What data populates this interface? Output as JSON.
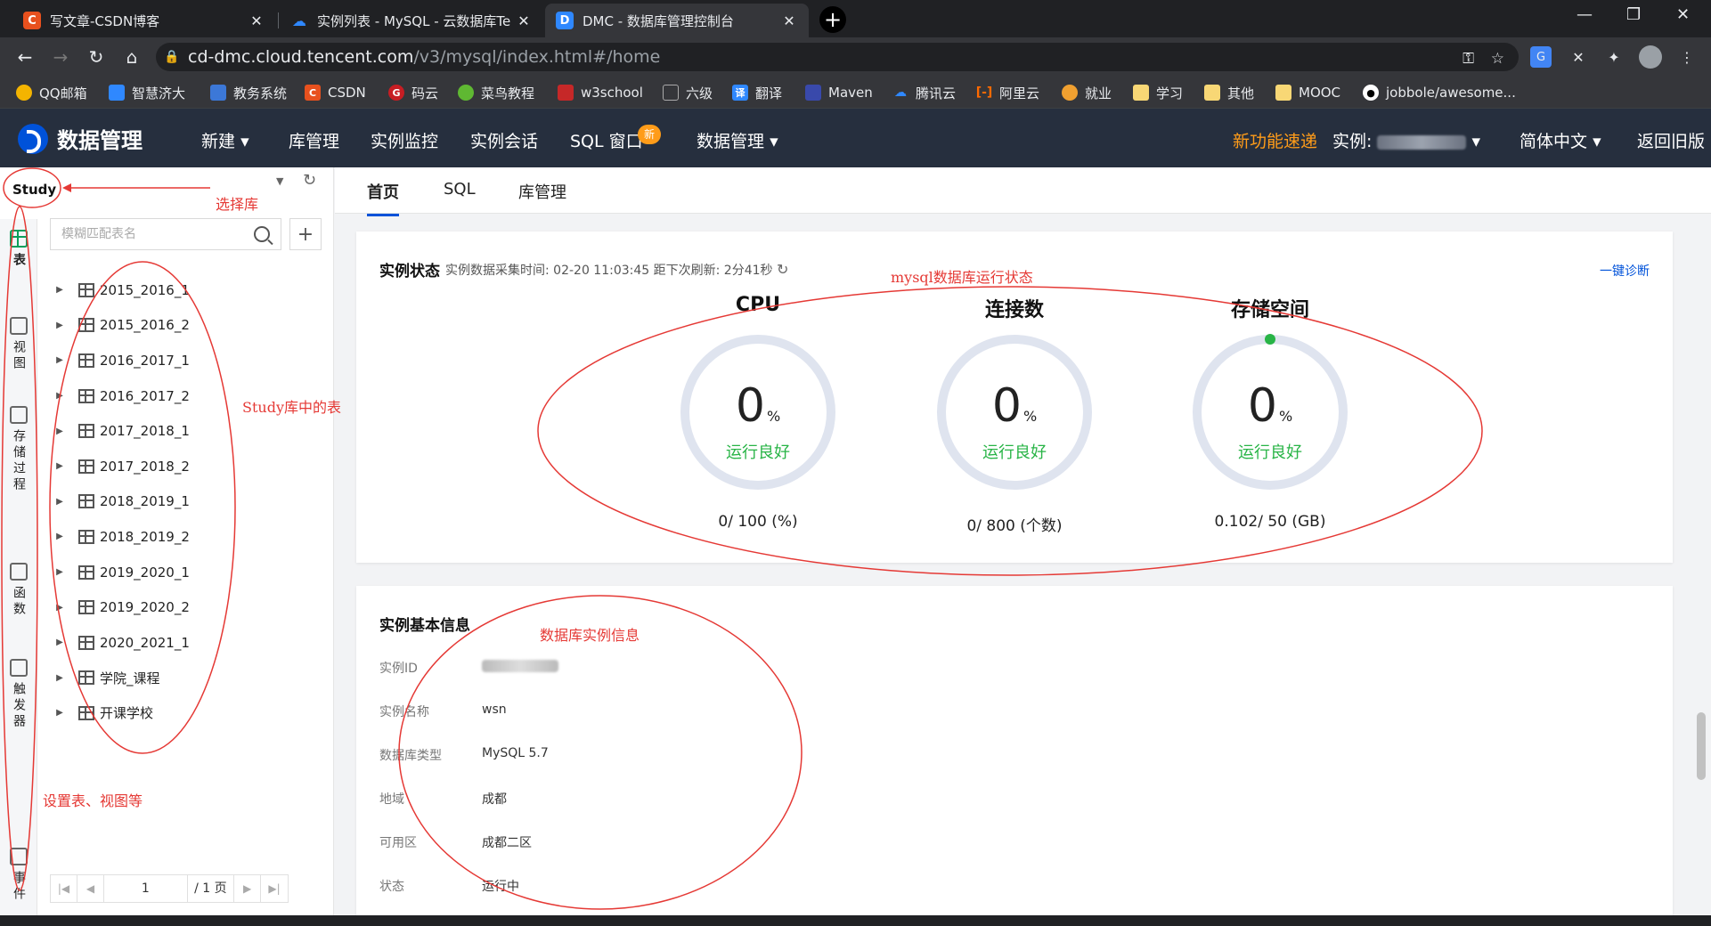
{
  "browser": {
    "tabs": [
      {
        "title": "写文章-CSDN博客",
        "favicon": "C",
        "color": "#e8511e"
      },
      {
        "title": "实例列表 - MySQL - 云数据库Te",
        "favicon": "☁",
        "color": "#2f88ff"
      },
      {
        "title": "DMC - 数据库管理控制台",
        "favicon": "D",
        "color": "#2f88ff"
      }
    ],
    "url_host": "cd-dmc.cloud.tencent.com",
    "url_path": "/v3/mysql/index.html#/home",
    "bookmarks": [
      "QQ邮箱",
      "智慧济大",
      "教务系统",
      "CSDN",
      "码云",
      "菜鸟教程",
      "w3school",
      "六级",
      "翻译",
      "Maven",
      "腾讯云",
      "阿里云",
      "就业",
      "学习",
      "其他",
      "MOOC",
      "jobbole/awesome..."
    ]
  },
  "app": {
    "logo_text": "数据管理",
    "nav": [
      "新建",
      "库管理",
      "实例监控",
      "实例会话",
      "SQL 窗口",
      "数据管理"
    ],
    "nav_caret": "▾",
    "new_badge": "新",
    "right": {
      "whats_new": "新功能速递",
      "instance_label": "实例:",
      "language": "简体中文",
      "back": "返回旧版"
    },
    "accent": "#0052d9",
    "highlight": "#ff9c19"
  },
  "left": {
    "database": "Study",
    "side_nav": [
      {
        "label": "表",
        "icon": "table-icon",
        "active": true
      },
      {
        "label": "视图",
        "icon": "view-icon"
      },
      {
        "label": "存储过程",
        "icon": "procedure-icon"
      },
      {
        "label": "函数",
        "icon": "function-icon"
      },
      {
        "label": "触发器",
        "icon": "trigger-icon"
      },
      {
        "label": "事件",
        "icon": "event-icon"
      }
    ],
    "search_placeholder": "模糊匹配表名",
    "tables": [
      "2015_2016_1",
      "2015_2016_2",
      "2016_2017_1",
      "2016_2017_2",
      "2017_2018_1",
      "2017_2018_2",
      "2018_2019_1",
      "2018_2019_2",
      "2019_2020_1",
      "2019_2020_2",
      "2020_2021_1",
      "学院_课程",
      "开课学校"
    ],
    "pager": {
      "page": "1",
      "total": "/ 1 页"
    }
  },
  "main": {
    "tabs": [
      "首页",
      "SQL",
      "库管理"
    ],
    "status": {
      "title": "实例状态",
      "subtitle": "实例数据采集时间: 02-20 11:03:45 距下次刷新: 2分41秒",
      "diagnose": "一键诊断",
      "gauges": [
        {
          "title": "CPU",
          "value": "0",
          "unit": "%",
          "status": "运行良好",
          "detail": "0/ 100 (%)"
        },
        {
          "title": "连接数",
          "value": "0",
          "unit": "%",
          "status": "运行良好",
          "detail": "0/ 800 (个数)"
        },
        {
          "title": "存储空间",
          "value": "0",
          "unit": "%",
          "status": "运行良好",
          "detail": "0.102/ 50 (GB)"
        }
      ]
    },
    "info": {
      "title": "实例基本信息",
      "rows": [
        {
          "key": "实例ID",
          "value": ""
        },
        {
          "key": "实例名称",
          "value": "wsn"
        },
        {
          "key": "数据库类型",
          "value": "MySQL 5.7"
        },
        {
          "key": "地域",
          "value": "成都"
        },
        {
          "key": "可用区",
          "value": "成都二区"
        },
        {
          "key": "状态",
          "value": "运行中"
        }
      ]
    }
  },
  "annotations": {
    "select_db": "选择库",
    "tables_in_study": "Study库中的表",
    "running_state": "mysql数据库运行状态",
    "instance_info": "数据库实例信息",
    "settings": "设置表、视图等"
  }
}
